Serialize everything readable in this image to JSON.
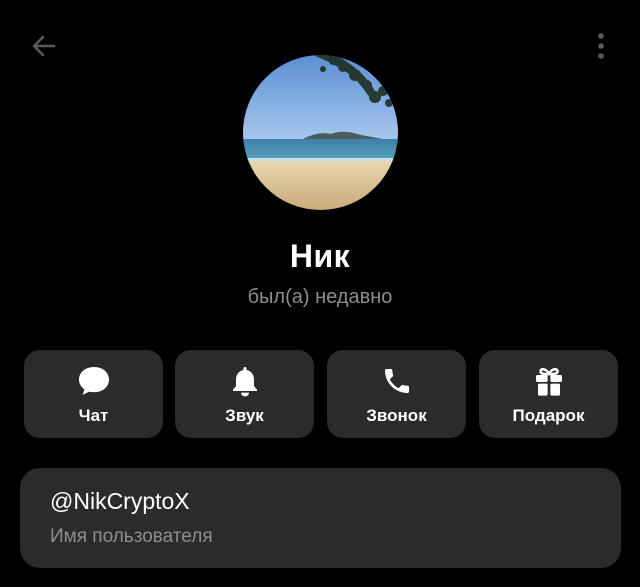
{
  "header": {
    "back_icon": "arrow-left-icon",
    "more_icon": "more-vertical-icon"
  },
  "profile": {
    "avatar_description": "beach-photo",
    "name": "Ник",
    "status": "был(а) недавно"
  },
  "actions": [
    {
      "label": "Чат",
      "icon": "chat-bubble-icon"
    },
    {
      "label": "Звук",
      "icon": "bell-icon"
    },
    {
      "label": "Звонок",
      "icon": "phone-icon"
    },
    {
      "label": "Подарок",
      "icon": "gift-icon"
    }
  ],
  "info": {
    "username": "@NikCryptoX",
    "username_label": "Имя пользователя"
  },
  "colors": {
    "background": "#000000",
    "card": "#2b2b2b",
    "primary_text": "#ffffff",
    "secondary_text": "#8d8d8d",
    "icon_dim": "#5a5a5a"
  }
}
